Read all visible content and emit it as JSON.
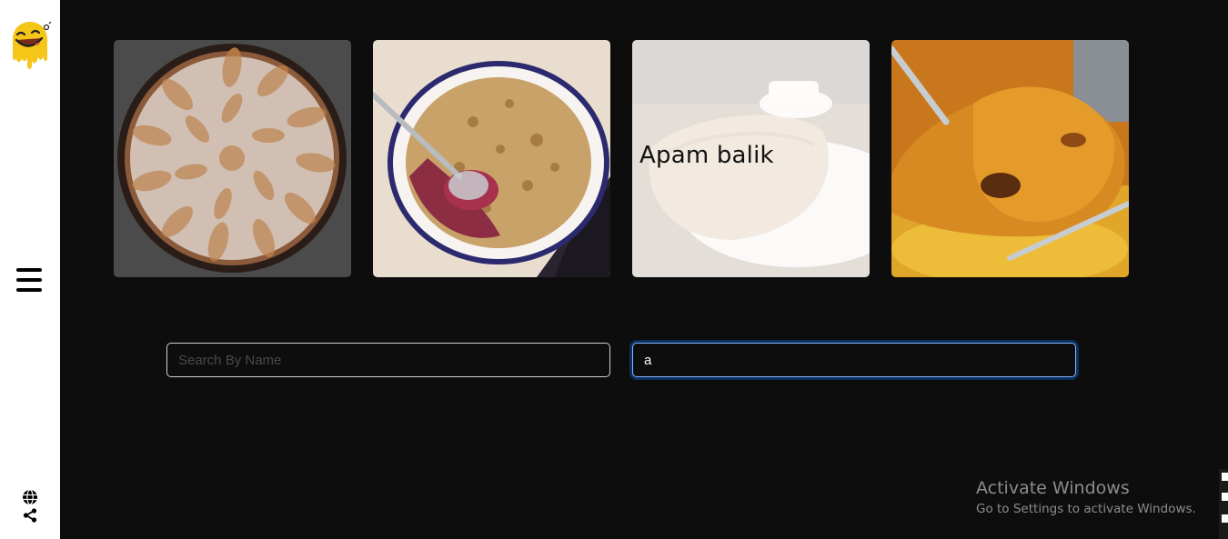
{
  "sidebar": {
    "logo": "smiley-drip-logo",
    "menu_icon": "hamburger-menu-icon",
    "globe_icon": "globe-icon",
    "share_icon": "share-icon"
  },
  "cards": [
    {
      "image": "apple-tart-image",
      "title": ""
    },
    {
      "image": "berry-crumble-image",
      "title": ""
    },
    {
      "image": "apam-balik-image",
      "title": "Apam balik"
    },
    {
      "image": "roast-chicken-image",
      "title": ""
    }
  ],
  "search": {
    "name_placeholder": "Search By Name",
    "name_value": "",
    "letter_value": "a"
  },
  "watermark": {
    "title": "Activate Windows",
    "subtitle": "Go to Settings to activate Windows."
  },
  "colors": {
    "background": "#0d0d0d",
    "sidebar": "#ffffff",
    "focus_border": "#86b7fe",
    "logo_yellow": "#f5c518"
  }
}
